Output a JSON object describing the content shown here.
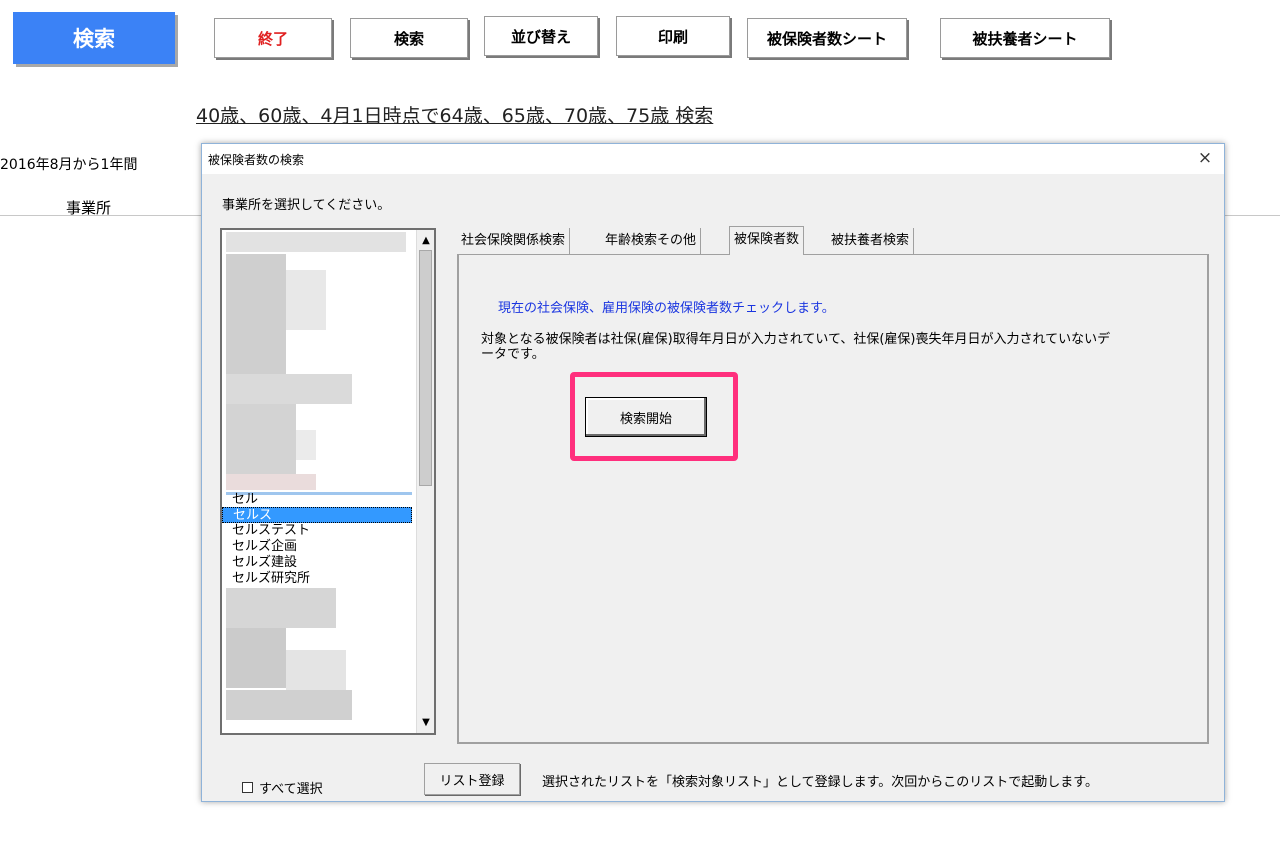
{
  "sheet": {
    "title_button": "検索",
    "toolbar": [
      {
        "label": "終了",
        "color": "#e02020"
      },
      {
        "label": "検索"
      },
      {
        "label": "並び替え"
      },
      {
        "label": "印刷"
      },
      {
        "label": "被保険者数シート"
      },
      {
        "label": "被扶養者シート"
      }
    ],
    "age_search_link": "40歳、60歳、4月1日時点で64歳、65歳、70歳、75歳 検索",
    "note_fragment": "2016年8月から1年間",
    "column_label": "事業所"
  },
  "dialog": {
    "title": "被保険者数の検索",
    "close_icon": "×",
    "prompt": "事業所を選択してください。",
    "list": {
      "items": [
        {
          "label": "セル",
          "selected": false
        },
        {
          "label": "セルス",
          "selected": true
        },
        {
          "label": "セルステスト",
          "selected": false
        },
        {
          "label": "セルズ企画",
          "selected": false
        },
        {
          "label": "セルズ建設",
          "selected": false
        },
        {
          "label": "セルズ研究所",
          "selected": false
        }
      ],
      "scroll_up_icon": "▲",
      "scroll_down_icon": "▼"
    },
    "tabs": [
      {
        "label": "社会保険関係検索",
        "active": false
      },
      {
        "label": "年齢検索その他",
        "active": false
      },
      {
        "label": "被保険者数",
        "active": true
      },
      {
        "label": "被扶養者検索",
        "active": false
      }
    ],
    "panel": {
      "info_text": "現在の社会保険、雇用保険の被保険者数チェックします。",
      "description": "対象となる被保険者は社保(雇保)取得年月日が入力されていて、社保(雇保)喪失年月日が入力されていないデータです。",
      "start_button": "検索開始",
      "highlight_color": "#ff2f7d"
    },
    "select_all": {
      "label": "すべて選択",
      "checked": false
    },
    "register_button": "リスト登録",
    "register_note": "選択されたリストを「検索対象リスト」として登録します。次回からこのリストで起動します。"
  }
}
